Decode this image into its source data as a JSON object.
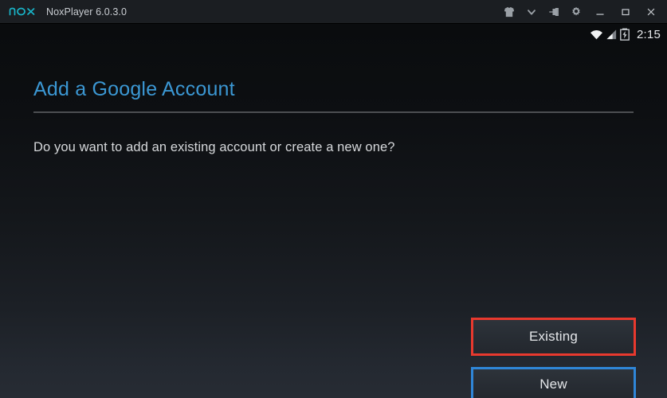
{
  "window": {
    "logo_text": "nox",
    "title": "NoxPlayer 6.0.3.0",
    "controls": [
      {
        "name": "theme-shirt-icon",
        "label": "Theme"
      },
      {
        "name": "chevron-down-icon",
        "label": "More"
      },
      {
        "name": "pin-icon",
        "label": "Pin on top"
      },
      {
        "name": "gear-icon",
        "label": "Settings"
      },
      {
        "name": "minimize-icon",
        "label": "Minimize"
      },
      {
        "name": "maximize-icon",
        "label": "Maximize"
      },
      {
        "name": "close-icon",
        "label": "Close"
      }
    ]
  },
  "statusbar": {
    "time": "2:15",
    "wifi_icon": "wifi-icon",
    "signal_icon": "cellular-signal-icon",
    "battery_icon": "battery-charging-icon"
  },
  "screen": {
    "title": "Add a Google Account",
    "body": "Do you want to add an existing account or create a new one?",
    "buttons": [
      {
        "label": "Existing",
        "highlight": "#e8392e"
      },
      {
        "label": "New",
        "highlight": "#2f86d8"
      }
    ]
  },
  "colors": {
    "accent_title": "#3b97d3",
    "logo": "#19b5c9",
    "titlebar_bg": "#1b1e22",
    "highlight_red": "#e8392e",
    "highlight_blue": "#2f86d8"
  }
}
